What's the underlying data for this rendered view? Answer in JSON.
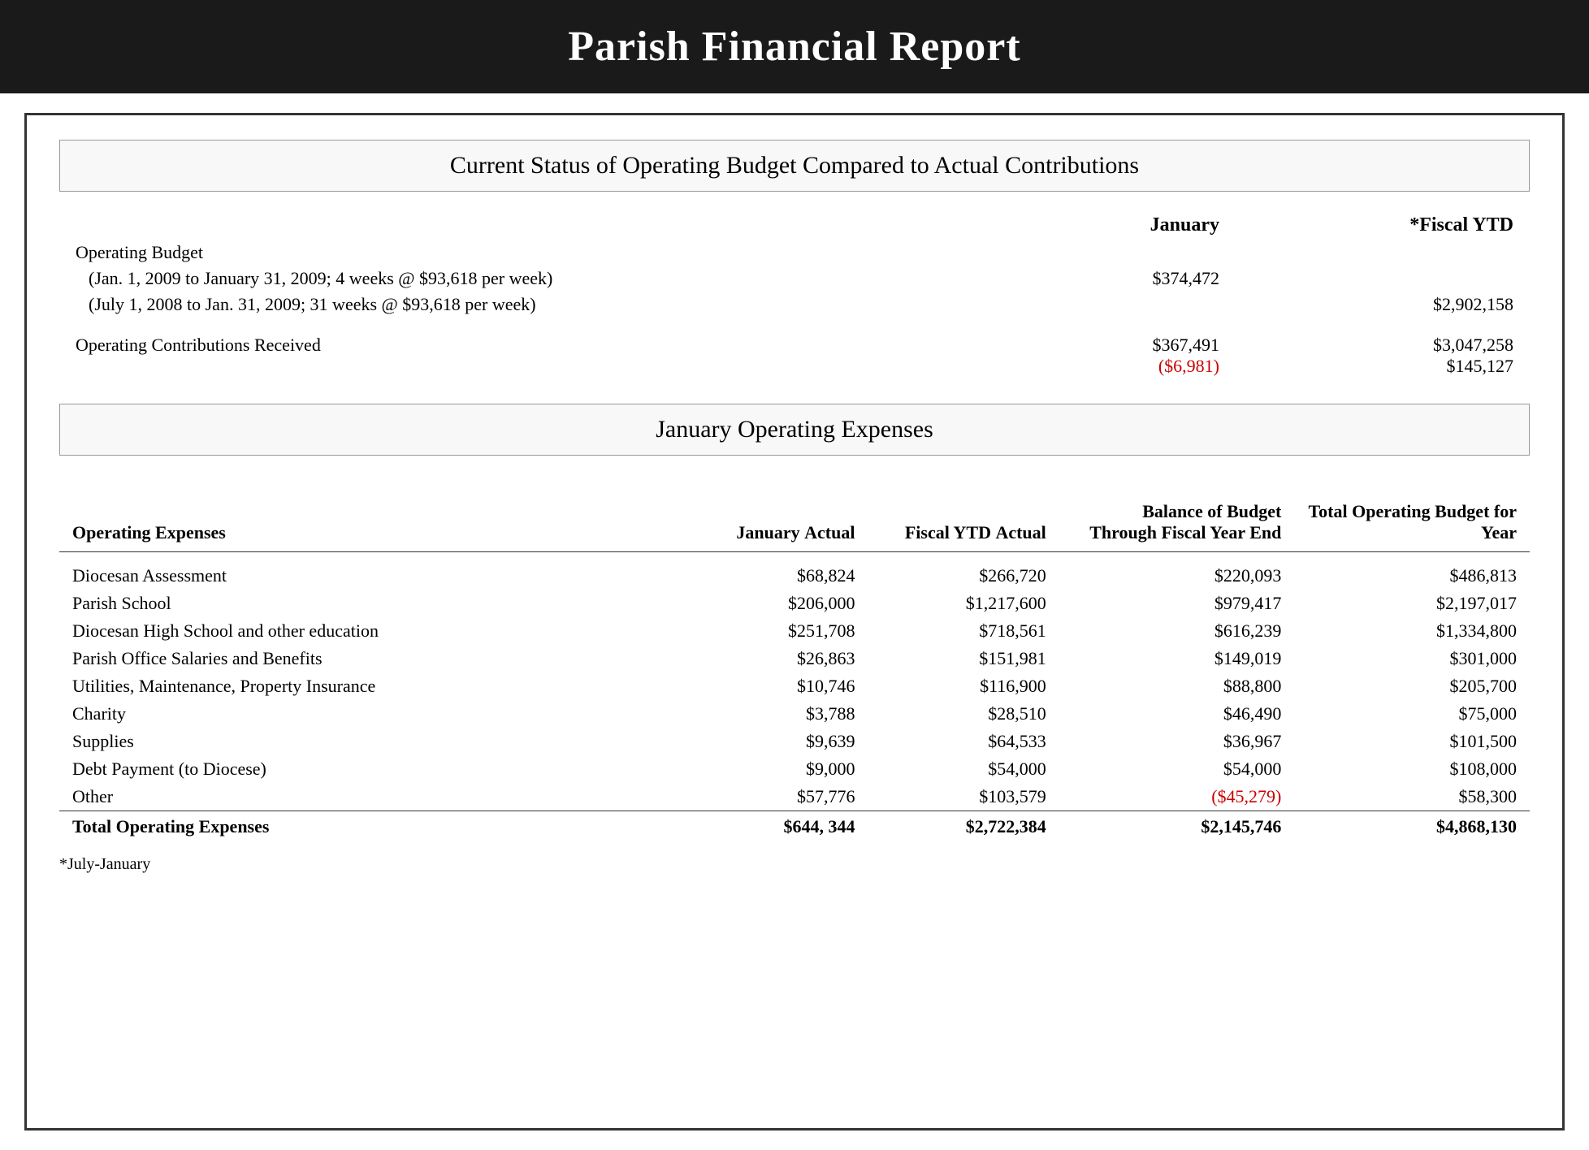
{
  "header": {
    "title": "Parish Financial Report"
  },
  "section1": {
    "title": "Current Status of Operating Budget Compared to Actual Contributions",
    "col_headers": {
      "january": "January",
      "fiscal_ytd": "*Fiscal YTD"
    },
    "operating_budget_label": "Operating Budget",
    "line1_label": "(Jan. 1, 2009 to January 31, 2009; 4 weeks @ $93,618 per week)",
    "line1_january": "$374,472",
    "line1_fiscal_ytd": "",
    "line2_label": "(July 1, 2008 to Jan. 31, 2009; 31 weeks @ $93,618 per week)",
    "line2_january": "",
    "line2_fiscal_ytd": "$2,902,158",
    "contributions_label": "Operating Contributions Received",
    "contributions_january": "$367,491",
    "contributions_january_diff": "($6,981)",
    "contributions_fiscal_ytd": "$3,047,258",
    "contributions_fiscal_ytd_diff": "$145,127"
  },
  "section2": {
    "title": "January Operating Expenses",
    "col_headers": {
      "label": "Operating Expenses",
      "jan_actual": "January Actual",
      "fiscal_ytd": "Fiscal YTD Actual",
      "balance": "Balance of Budget Through Fiscal Year End",
      "total_budget": "Total Operating Budget for Year"
    },
    "rows": [
      {
        "label": "Diocesan Assessment",
        "jan_actual": "$68,824",
        "fiscal_ytd": "$266,720",
        "balance": "$220,093",
        "total_budget": "$486,813",
        "red_balance": false
      },
      {
        "label": "Parish School",
        "jan_actual": "$206,000",
        "fiscal_ytd": "$1,217,600",
        "balance": "$979,417",
        "total_budget": "$2,197,017",
        "red_balance": false
      },
      {
        "label": "Diocesan High School and other education",
        "jan_actual": "$251,708",
        "fiscal_ytd": "$718,561",
        "balance": "$616,239",
        "total_budget": "$1,334,800",
        "red_balance": false
      },
      {
        "label": "Parish Office Salaries and Benefits",
        "jan_actual": "$26,863",
        "fiscal_ytd": "$151,981",
        "balance": "$149,019",
        "total_budget": "$301,000",
        "red_balance": false
      },
      {
        "label": "Utilities, Maintenance, Property Insurance",
        "jan_actual": "$10,746",
        "fiscal_ytd": "$116,900",
        "balance": "$88,800",
        "total_budget": "$205,700",
        "red_balance": false
      },
      {
        "label": "Charity",
        "jan_actual": "$3,788",
        "fiscal_ytd": "$28,510",
        "balance": "$46,490",
        "total_budget": "$75,000",
        "red_balance": false
      },
      {
        "label": "Supplies",
        "jan_actual": "$9,639",
        "fiscal_ytd": "$64,533",
        "balance": "$36,967",
        "total_budget": "$101,500",
        "red_balance": false
      },
      {
        "label": "Debt Payment (to Diocese)",
        "jan_actual": "$9,000",
        "fiscal_ytd": "$54,000",
        "balance": "$54,000",
        "total_budget": "$108,000",
        "red_balance": false
      },
      {
        "label": "Other",
        "jan_actual": "$57,776",
        "fiscal_ytd": "$103,579",
        "balance": "($45,279)",
        "total_budget": "$58,300",
        "red_balance": true
      }
    ],
    "totals": {
      "label": "Total Operating Expenses",
      "jan_actual": "$644, 344",
      "fiscal_ytd": "$2,722,384",
      "balance": "$2,145,746",
      "total_budget": "$4,868,130"
    },
    "footnote": "*July-January"
  }
}
